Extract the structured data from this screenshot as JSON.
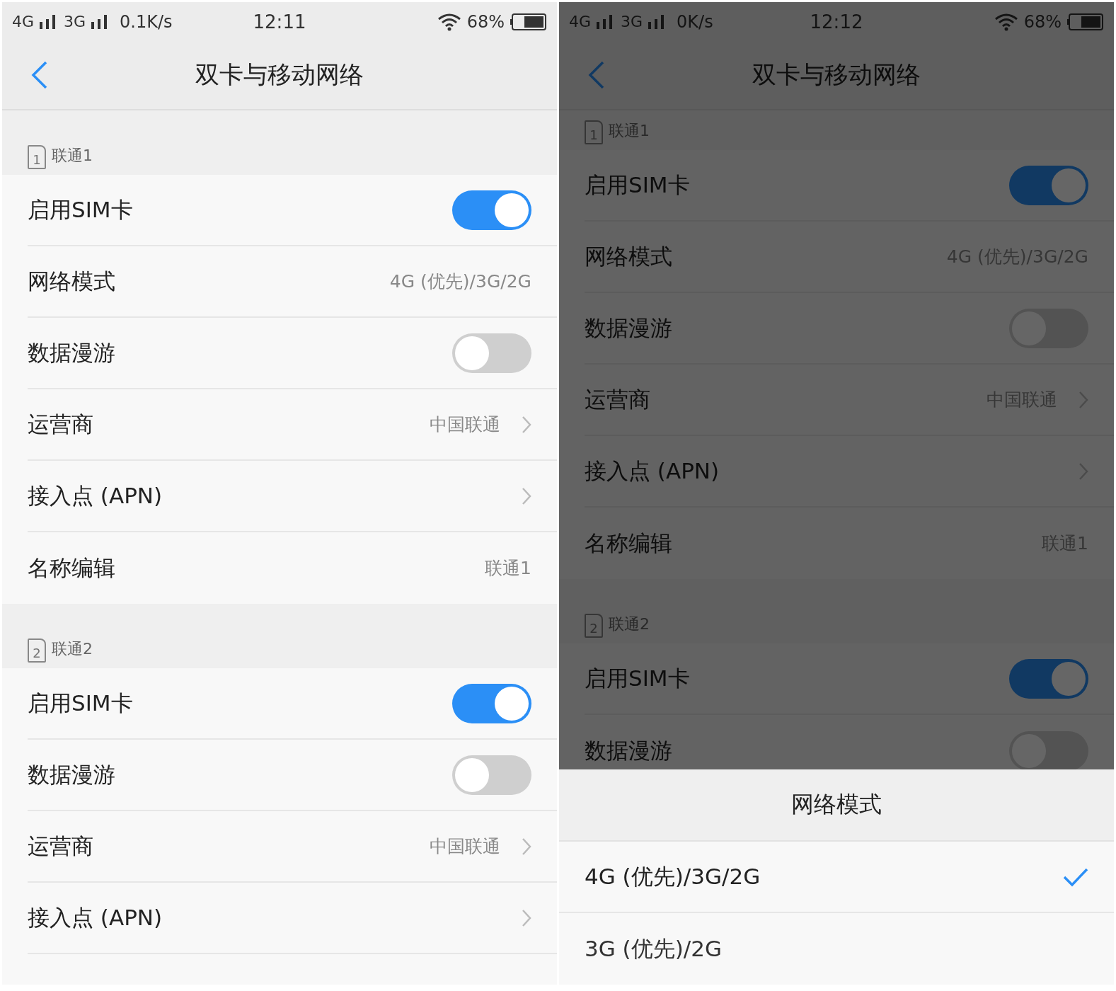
{
  "phones": [
    {
      "status_bar": {
        "network_1": "4G",
        "network_2": "3G",
        "speed": "0.1K/s",
        "time": "12:11",
        "battery": "68%"
      },
      "scrolled": false,
      "title": "双卡与移动网络",
      "sections": [
        {
          "sim_number": "1",
          "label": "联通1",
          "rows": [
            {
              "kind": "toggle",
              "label": "启用SIM卡",
              "on": true
            },
            {
              "kind": "value",
              "label": "网络模式",
              "value": "4G (优先)/3G/2G"
            },
            {
              "kind": "toggle",
              "label": "数据漫游",
              "on": false
            },
            {
              "kind": "link",
              "label": "运营商",
              "value": "中国联通"
            },
            {
              "kind": "link",
              "label": "接入点 (APN)"
            },
            {
              "kind": "value",
              "label": "名称编辑",
              "value": "联通1"
            }
          ]
        },
        {
          "sim_number": "2",
          "label": "联通2",
          "rows": [
            {
              "kind": "toggle",
              "label": "启用SIM卡",
              "on": true
            },
            {
              "kind": "toggle",
              "label": "数据漫游",
              "on": false
            },
            {
              "kind": "link",
              "label": "运营商",
              "value": "中国联通"
            },
            {
              "kind": "link",
              "label": "接入点 (APN)"
            },
            {
              "kind": "blank"
            }
          ]
        }
      ]
    },
    {
      "status_bar": {
        "network_1": "4G",
        "network_2": "3G",
        "speed": "0K/s",
        "time": "12:12",
        "battery": "68%"
      },
      "scrolled": true,
      "title": "双卡与移动网络",
      "sections": [
        {
          "sim_number": "1",
          "label": "联通1",
          "rows": [
            {
              "kind": "toggle",
              "label": "启用SIM卡",
              "on": true
            },
            {
              "kind": "value",
              "label": "网络模式",
              "value": "4G (优先)/3G/2G"
            },
            {
              "kind": "toggle",
              "label": "数据漫游",
              "on": false
            },
            {
              "kind": "link",
              "label": "运营商",
              "value": "中国联通"
            },
            {
              "kind": "link",
              "label": "接入点 (APN)"
            },
            {
              "kind": "value",
              "label": "名称编辑",
              "value": "联通1"
            }
          ]
        },
        {
          "sim_number": "2",
          "label": "联通2",
          "rows": [
            {
              "kind": "toggle",
              "label": "启用SIM卡",
              "on": true
            },
            {
              "kind": "toggle",
              "label": "数据漫游",
              "on": false
            }
          ]
        }
      ],
      "sheet": {
        "title": "网络模式",
        "options": [
          {
            "label": "4G (优先)/3G/2G",
            "selected": true
          },
          {
            "label": "3G (优先)/2G",
            "selected": false
          }
        ]
      }
    }
  ]
}
